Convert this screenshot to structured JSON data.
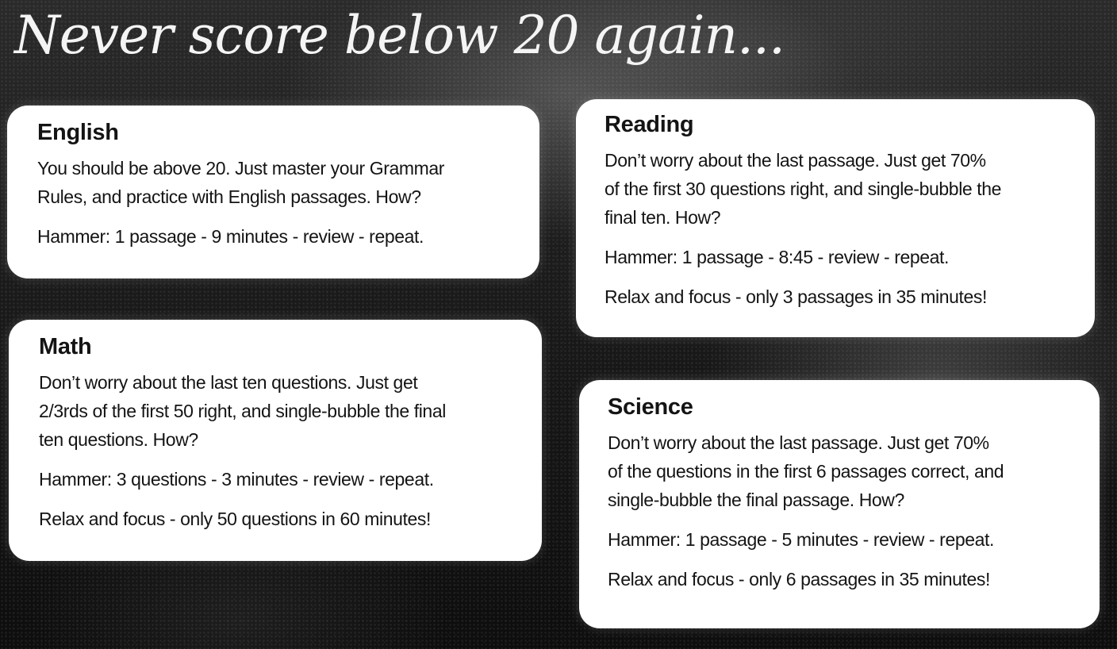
{
  "headline": "Never score below 20 again...",
  "cards": {
    "english": {
      "title": "English",
      "lines": [
        "You should be above 20. Just master your Grammar",
        "Rules, and practice with English passages. How?",
        "Hammer: 1 passage - 9 minutes - review - repeat."
      ]
    },
    "math": {
      "title": "Math",
      "lines": [
        "Don’t worry about the last ten questions. Just get",
        "2/3rds of the first 50 right, and single-bubble the final",
        "ten questions. How?",
        "Hammer: 3 questions - 3 minutes - review - repeat.",
        "Relax and focus - only 50 questions in 60 minutes!"
      ]
    },
    "reading": {
      "title": "Reading",
      "lines": [
        "Don’t worry about the last passage. Just get 70%",
        "of the first 30 questions right, and single-bubble the",
        "final ten. How?",
        "Hammer: 1 passage - 8:45 - review - repeat.",
        "Relax and focus - only 3 passages in 35 minutes!"
      ]
    },
    "science": {
      "title": "Science",
      "lines": [
        "Don’t worry about the last passage. Just get 70%",
        "of the questions in the first 6 passages correct, and",
        "single-bubble the final passage. How?",
        "Hammer: 1 passage - 5 minutes - review - repeat.",
        "Relax and focus - only 6 passages in 35 minutes!"
      ]
    }
  }
}
